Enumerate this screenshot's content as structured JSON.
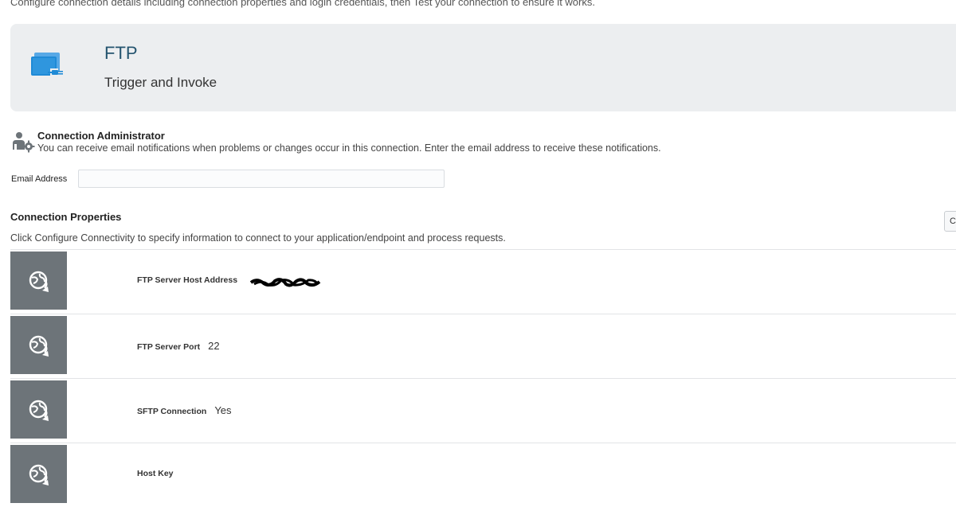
{
  "intro_text": "Configure connection details including connection properties and login credentials, then Test your connection to ensure it works.",
  "connection": {
    "title": "FTP",
    "role": "Trigger and Invoke"
  },
  "admin": {
    "title": "Connection Administrator",
    "description": "You can receive email notifications when problems or changes occur in this connection. Enter the email address to receive these notifications.",
    "email_label": "Email Address",
    "email_value": ""
  },
  "properties": {
    "title": "Connection Properties",
    "description": "Click Configure Connectivity to specify information to connect to your application/endpoint and process requests.",
    "configure_button_label": "C",
    "items": [
      {
        "label": "FTP Server Host Address",
        "value": ""
      },
      {
        "label": "FTP Server Port",
        "value": "22"
      },
      {
        "label": "SFTP Connection",
        "value": "Yes"
      },
      {
        "label": "Host Key",
        "value": ""
      }
    ]
  },
  "icons": {
    "banner": "adapter-plug-icon",
    "admin": "user-settings-icon",
    "property": "globe-refresh-icon"
  },
  "colors": {
    "banner_bg": "#eceef0",
    "title_color": "#24546f",
    "icon_blue": "#1f8ad6",
    "tile_bg": "#6d7479"
  }
}
